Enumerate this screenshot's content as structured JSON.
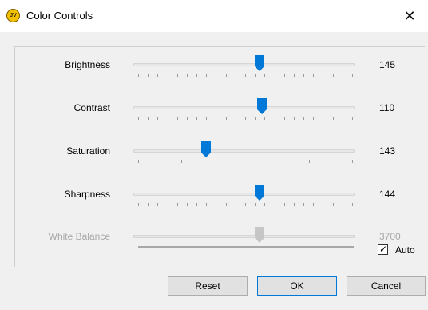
{
  "window": {
    "title": "Color Controls",
    "app_icon_text": "JV",
    "close_glyph": "✕"
  },
  "controls": [
    {
      "label": "Brightness",
      "value": "145",
      "level": 0.57,
      "ticks": 23,
      "enabled": true
    },
    {
      "label": "Contrast",
      "value": "110",
      "level": 0.58,
      "ticks": 23,
      "enabled": true
    },
    {
      "label": "Saturation",
      "value": "143",
      "level": 0.33,
      "ticks": 6,
      "enabled": true
    },
    {
      "label": "Sharpness",
      "value": "144",
      "level": 0.57,
      "ticks": 23,
      "enabled": true
    },
    {
      "label": "White Balance",
      "value": "3700",
      "level": 0.57,
      "ticks": 0,
      "enabled": false
    }
  ],
  "auto": {
    "label": "Auto",
    "checked": true
  },
  "buttons": {
    "reset": "Reset",
    "ok": "OK",
    "cancel": "Cancel"
  },
  "colors": {
    "thumb": "#0078d7",
    "thumb_disabled": "#c6c6c6"
  }
}
